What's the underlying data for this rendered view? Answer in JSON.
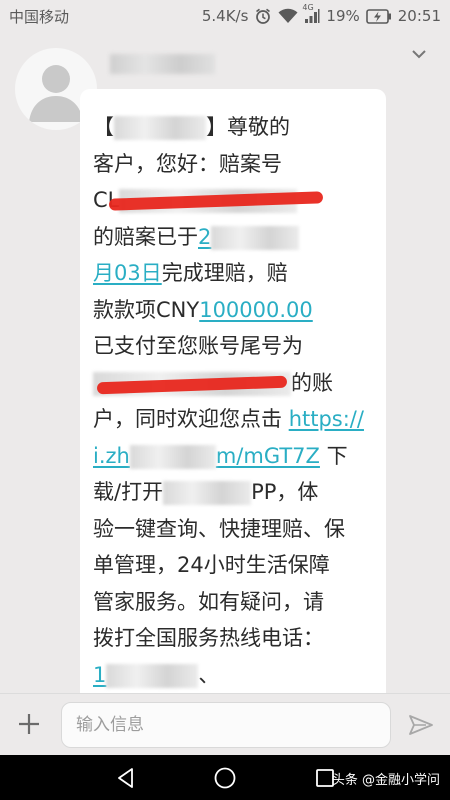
{
  "status_bar": {
    "carrier": "中国移动",
    "speed": "5.4K/s",
    "network": "4G",
    "battery": "19%",
    "time": "20:51"
  },
  "message": {
    "bracket_open": "【",
    "bracket_close": "】",
    "p1": "尊敬的",
    "p2": "客户，您好：赔案号",
    "p3_start": "CL",
    "p4_text": "的赔案已于",
    "p4_link_start": "2",
    "p5_link": "月03日",
    "p5_text": "完成理赔，赔",
    "p6_text": "款款项CNY",
    "p6_link": "100000.00",
    "p7": "已支付至您账号尾号为",
    "p8_end": "的账",
    "p9_text": "户，同时欢迎您点击 ",
    "p9_link": "https://",
    "p10_link_start": "i.zh",
    "p10_link_end": "m/mGT7Z",
    "p10_text": " 下",
    "p11_start": "载/打开",
    "p11_end": "PP，体",
    "p12": "验一键查询、快捷理赔、保",
    "p13": "单管理，24小时生活保障",
    "p14": "管家服务。如有疑问，请",
    "p15": "拨打全国服务热线电话：",
    "p16_link": "1",
    "p16_end": "、"
  },
  "input": {
    "placeholder": "输入信息"
  },
  "watermark": {
    "prefix": "头条",
    "handle": "@金融小学问"
  },
  "colors": {
    "link": "#2aaec4",
    "redact_red": "#e8271d",
    "background": "#eceaea"
  }
}
